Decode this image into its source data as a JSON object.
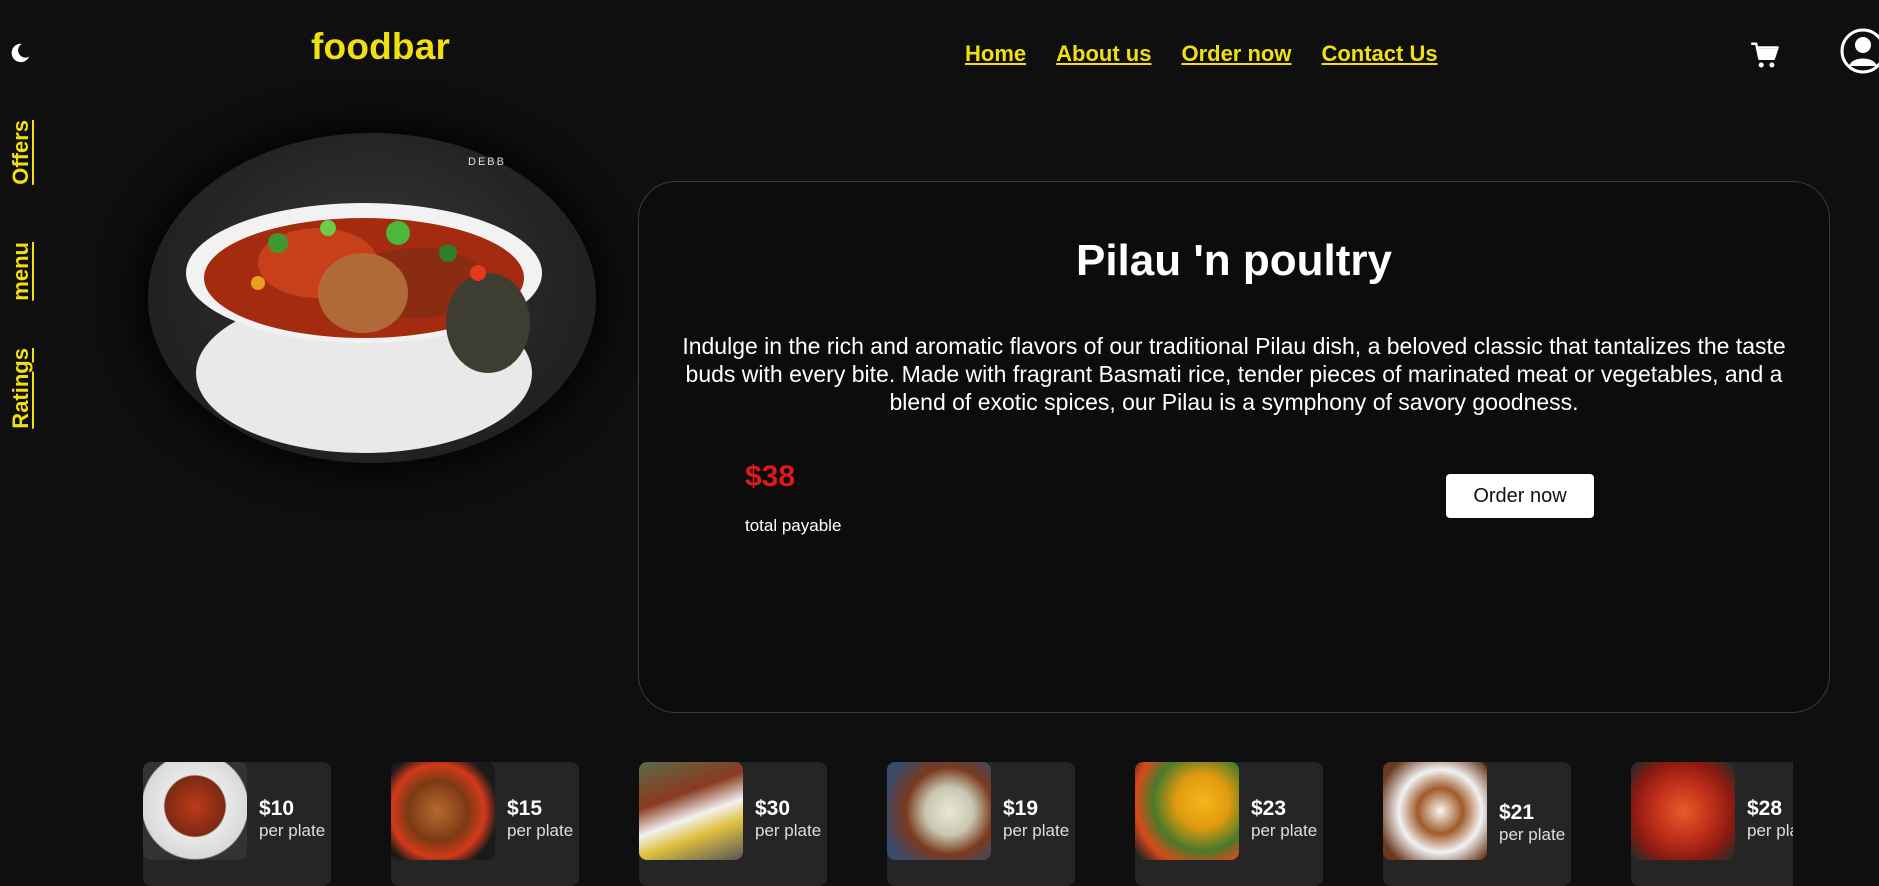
{
  "header": {
    "logo": "foodbar",
    "nav": [
      "Home",
      "About us",
      "Order now",
      "Contact Us"
    ],
    "icons": [
      "moon-icon",
      "cart-icon",
      "user-profile-icon"
    ]
  },
  "sidebar": {
    "links": [
      "Offers",
      "menu",
      "Ratings"
    ]
  },
  "hero": {
    "image": "pilau-dish-in-white-bowl",
    "watermark": "DEBB"
  },
  "card": {
    "title": "Pilau 'n poultry",
    "description": "Indulge in the rich and aromatic flavors of our traditional Pilau dish, a beloved classic that tantalizes the taste buds with every bite. Made with fragrant Basmati rice, tender pieces of marinated meat or vegetables, and a blend of exotic spices, our Pilau is a symphony of savory goodness.",
    "price": "$38",
    "price_label": "total payable",
    "order_button": "Order now"
  },
  "menu_items": [
    {
      "price": "$10",
      "unit": "per plate"
    },
    {
      "price": "$15",
      "unit": "per plate"
    },
    {
      "price": "$30",
      "unit": "per plate"
    },
    {
      "price": "$19",
      "unit": "per plate"
    },
    {
      "price": "$23",
      "unit": "per plate"
    },
    {
      "price": "$21",
      "unit": "per plate"
    },
    {
      "price": "$28",
      "unit": "per plate"
    }
  ],
  "colors": {
    "background": "#0f0f0f",
    "accent": "#f2df12",
    "price": "#e01818",
    "card_item": "#252525"
  }
}
